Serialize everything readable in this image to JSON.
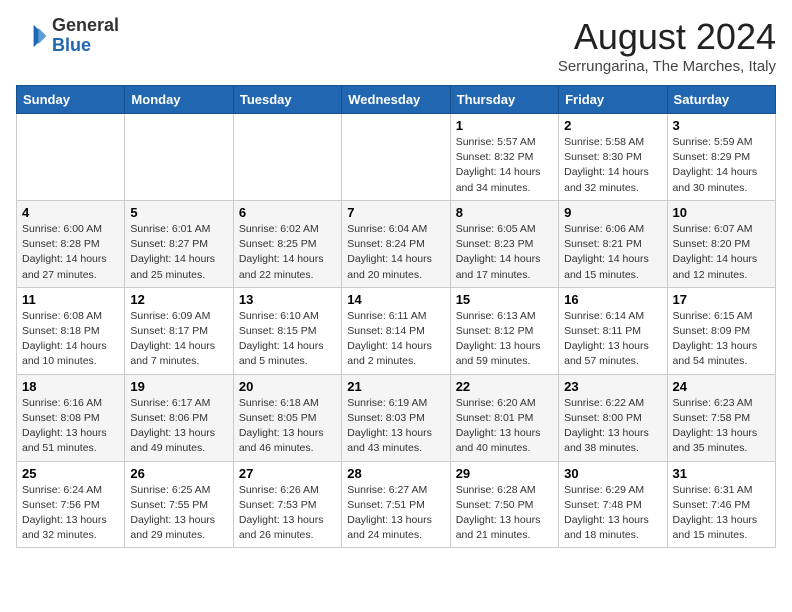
{
  "logo": {
    "general": "General",
    "blue": "Blue"
  },
  "title": "August 2024",
  "subtitle": "Serrungarina, The Marches, Italy",
  "days_header": [
    "Sunday",
    "Monday",
    "Tuesday",
    "Wednesday",
    "Thursday",
    "Friday",
    "Saturday"
  ],
  "weeks": [
    [
      {
        "day": "",
        "info": ""
      },
      {
        "day": "",
        "info": ""
      },
      {
        "day": "",
        "info": ""
      },
      {
        "day": "",
        "info": ""
      },
      {
        "day": "1",
        "info": "Sunrise: 5:57 AM\nSunset: 8:32 PM\nDaylight: 14 hours and 34 minutes."
      },
      {
        "day": "2",
        "info": "Sunrise: 5:58 AM\nSunset: 8:30 PM\nDaylight: 14 hours and 32 minutes."
      },
      {
        "day": "3",
        "info": "Sunrise: 5:59 AM\nSunset: 8:29 PM\nDaylight: 14 hours and 30 minutes."
      }
    ],
    [
      {
        "day": "4",
        "info": "Sunrise: 6:00 AM\nSunset: 8:28 PM\nDaylight: 14 hours and 27 minutes."
      },
      {
        "day": "5",
        "info": "Sunrise: 6:01 AM\nSunset: 8:27 PM\nDaylight: 14 hours and 25 minutes."
      },
      {
        "day": "6",
        "info": "Sunrise: 6:02 AM\nSunset: 8:25 PM\nDaylight: 14 hours and 22 minutes."
      },
      {
        "day": "7",
        "info": "Sunrise: 6:04 AM\nSunset: 8:24 PM\nDaylight: 14 hours and 20 minutes."
      },
      {
        "day": "8",
        "info": "Sunrise: 6:05 AM\nSunset: 8:23 PM\nDaylight: 14 hours and 17 minutes."
      },
      {
        "day": "9",
        "info": "Sunrise: 6:06 AM\nSunset: 8:21 PM\nDaylight: 14 hours and 15 minutes."
      },
      {
        "day": "10",
        "info": "Sunrise: 6:07 AM\nSunset: 8:20 PM\nDaylight: 14 hours and 12 minutes."
      }
    ],
    [
      {
        "day": "11",
        "info": "Sunrise: 6:08 AM\nSunset: 8:18 PM\nDaylight: 14 hours and 10 minutes."
      },
      {
        "day": "12",
        "info": "Sunrise: 6:09 AM\nSunset: 8:17 PM\nDaylight: 14 hours and 7 minutes."
      },
      {
        "day": "13",
        "info": "Sunrise: 6:10 AM\nSunset: 8:15 PM\nDaylight: 14 hours and 5 minutes."
      },
      {
        "day": "14",
        "info": "Sunrise: 6:11 AM\nSunset: 8:14 PM\nDaylight: 14 hours and 2 minutes."
      },
      {
        "day": "15",
        "info": "Sunrise: 6:13 AM\nSunset: 8:12 PM\nDaylight: 13 hours and 59 minutes."
      },
      {
        "day": "16",
        "info": "Sunrise: 6:14 AM\nSunset: 8:11 PM\nDaylight: 13 hours and 57 minutes."
      },
      {
        "day": "17",
        "info": "Sunrise: 6:15 AM\nSunset: 8:09 PM\nDaylight: 13 hours and 54 minutes."
      }
    ],
    [
      {
        "day": "18",
        "info": "Sunrise: 6:16 AM\nSunset: 8:08 PM\nDaylight: 13 hours and 51 minutes."
      },
      {
        "day": "19",
        "info": "Sunrise: 6:17 AM\nSunset: 8:06 PM\nDaylight: 13 hours and 49 minutes."
      },
      {
        "day": "20",
        "info": "Sunrise: 6:18 AM\nSunset: 8:05 PM\nDaylight: 13 hours and 46 minutes."
      },
      {
        "day": "21",
        "info": "Sunrise: 6:19 AM\nSunset: 8:03 PM\nDaylight: 13 hours and 43 minutes."
      },
      {
        "day": "22",
        "info": "Sunrise: 6:20 AM\nSunset: 8:01 PM\nDaylight: 13 hours and 40 minutes."
      },
      {
        "day": "23",
        "info": "Sunrise: 6:22 AM\nSunset: 8:00 PM\nDaylight: 13 hours and 38 minutes."
      },
      {
        "day": "24",
        "info": "Sunrise: 6:23 AM\nSunset: 7:58 PM\nDaylight: 13 hours and 35 minutes."
      }
    ],
    [
      {
        "day": "25",
        "info": "Sunrise: 6:24 AM\nSunset: 7:56 PM\nDaylight: 13 hours and 32 minutes."
      },
      {
        "day": "26",
        "info": "Sunrise: 6:25 AM\nSunset: 7:55 PM\nDaylight: 13 hours and 29 minutes."
      },
      {
        "day": "27",
        "info": "Sunrise: 6:26 AM\nSunset: 7:53 PM\nDaylight: 13 hours and 26 minutes."
      },
      {
        "day": "28",
        "info": "Sunrise: 6:27 AM\nSunset: 7:51 PM\nDaylight: 13 hours and 24 minutes."
      },
      {
        "day": "29",
        "info": "Sunrise: 6:28 AM\nSunset: 7:50 PM\nDaylight: 13 hours and 21 minutes."
      },
      {
        "day": "30",
        "info": "Sunrise: 6:29 AM\nSunset: 7:48 PM\nDaylight: 13 hours and 18 minutes."
      },
      {
        "day": "31",
        "info": "Sunrise: 6:31 AM\nSunset: 7:46 PM\nDaylight: 13 hours and 15 minutes."
      }
    ]
  ]
}
